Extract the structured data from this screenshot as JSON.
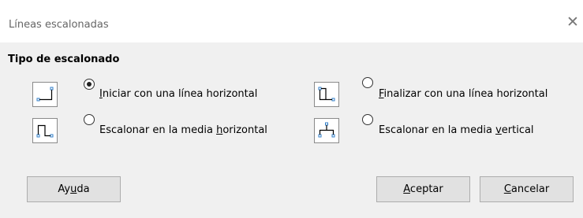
{
  "window": {
    "title": "Líneas escalonadas",
    "close_glyph": "✕"
  },
  "section": {
    "title": "Tipo de escalonado"
  },
  "options": [
    {
      "label_before": "",
      "mnemonic": "I",
      "label_after": "niciar con una línea horizontal",
      "checked": true,
      "icon": "step-start-horizontal-icon"
    },
    {
      "label_before": "",
      "mnemonic": "F",
      "label_after": "inalizar con una línea horizontal",
      "checked": false,
      "icon": "step-end-horizontal-icon"
    },
    {
      "label_before": "Escalonar en la media ",
      "mnemonic": "h",
      "label_after": "orizontal",
      "checked": false,
      "icon": "step-center-horizontal-icon"
    },
    {
      "label_before": "Escalonar en la media ",
      "mnemonic": "v",
      "label_after": "ertical",
      "checked": false,
      "icon": "step-center-vertical-icon"
    }
  ],
  "buttons": {
    "help": {
      "before": "Ay",
      "mnemonic": "u",
      "after": "da"
    },
    "ok": {
      "before": "",
      "mnemonic": "A",
      "after": "ceptar"
    },
    "cancel": {
      "before": "",
      "mnemonic": "C",
      "after": "ancelar"
    }
  },
  "colors": {
    "dialog_bg": "#f0f0f0",
    "button_bg": "#e1e1e1",
    "icon_stroke": "#2f7ec8"
  }
}
